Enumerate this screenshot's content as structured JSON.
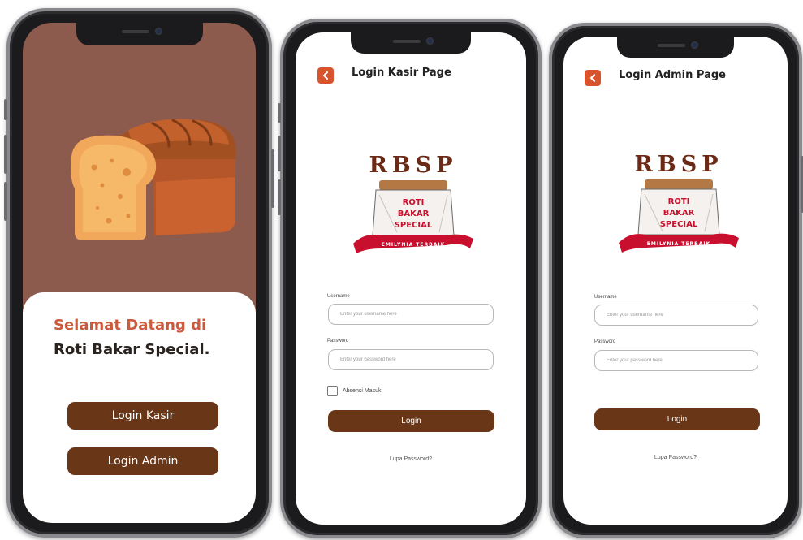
{
  "welcome_screen": {
    "line1": "Selamat Datang di",
    "line2": "Roti Bakar Special.",
    "login_kasir_label": "Login Kasir",
    "login_admin_label": "Login Admin"
  },
  "logo": {
    "initials": "RBSP",
    "bag_text": [
      "ROTI",
      "BAKAR",
      "SPECIAL"
    ],
    "ribbon_text": "EMILYNIA TERBAIK"
  },
  "kasir_login": {
    "title": "Login Kasir Page",
    "username_label": "Username",
    "username_placeholder": "Enter your username here",
    "password_label": "Password",
    "password_placeholder": "Enter your password here",
    "checkbox_label": "Absensi Masuk",
    "login_label": "Login",
    "forgot_label": "Lupa Password?"
  },
  "admin_login": {
    "title": "Login Admin Page",
    "username_label": "Username",
    "username_placeholder": "Enter your username here",
    "password_label": "Password",
    "password_placeholder": "Enter your password here",
    "login_label": "Login",
    "forgot_label": "Lupa Password?"
  },
  "colors": {
    "background_brown": "#8d5b4d",
    "button_brown": "#6a3618",
    "accent_orange": "#d9542c",
    "heading_orange": "#cc5a3c",
    "logo_red": "#c8102e"
  },
  "icons": {
    "back": "chevron-left-icon",
    "bread": "bread-loaf-illustration"
  }
}
